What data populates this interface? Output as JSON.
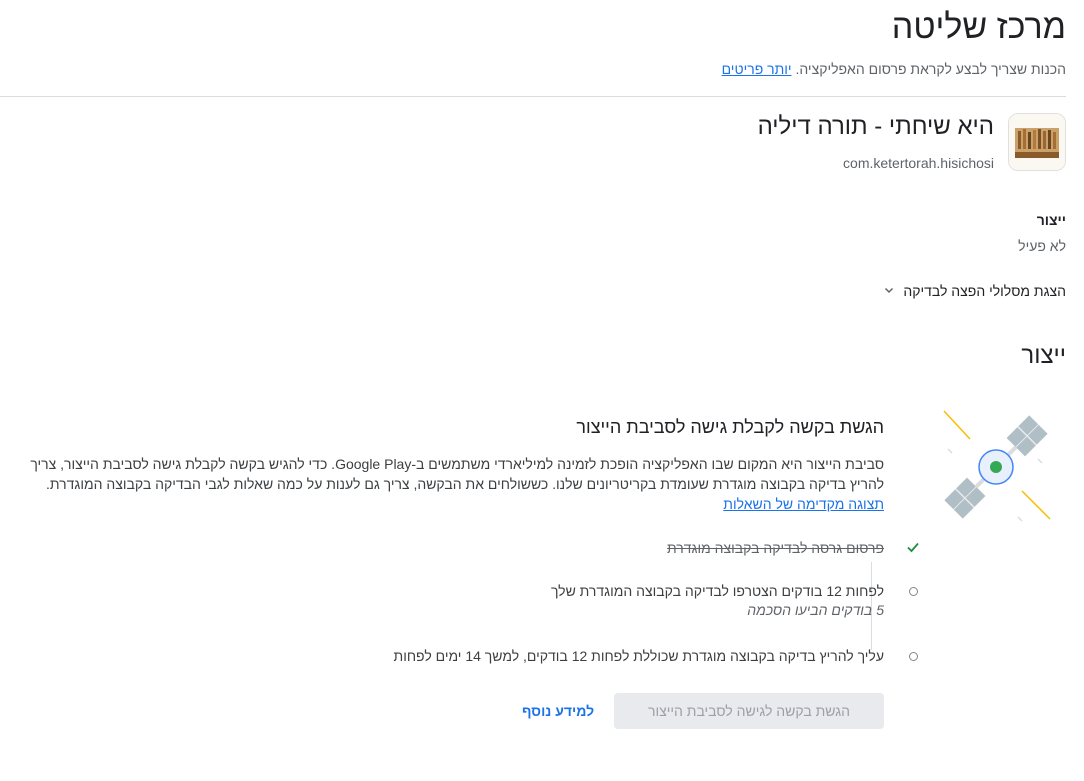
{
  "header": {
    "title": "מרכז שליטה",
    "subtitle": "הכנות שצריך לבצע לקראת פרסום האפליקציה.",
    "more_details_link": "יותר פריטים"
  },
  "app": {
    "name": "היא שיחתי - תורה דיליה",
    "package": "com.ketertorah.hisichosi",
    "icon_text": "היא שיחתי"
  },
  "production_status": {
    "label": "ייצור",
    "value": "לא פעיל"
  },
  "tracks_toggle_label": "הצגת מסלולי הפצה לבדיקה",
  "section": {
    "heading": "ייצור"
  },
  "card": {
    "title": "הגשת בקשה לקבלת גישה לסביבת הייצור",
    "body": "סביבת הייצור היא המקום שבו האפליקציה הופכת לזמינה למיליארדי משתמשים ב-Google Play. כדי להגיש בקשה לקבלת גישה לסביבת הייצור, צריך להריץ בדיקה בקבוצה מוגדרת שעומדת בקריטריונים שלנו. כששולחים את הבקשה, צריך גם לענות על כמה שאלות לגבי הבדיקה בקבוצה המוגדרת.",
    "preview_link": "תצוגה מקדימה של השאלות",
    "steps": [
      {
        "text": "פרסום גרסה לבדיקה בקבוצה מוגדרת",
        "done": true
      },
      {
        "text": "לפחות 12 בודקים הצטרפו לבדיקה בקבוצה המוגדרת שלך",
        "sub": "5 בודקים הביעו הסכמה",
        "done": false
      },
      {
        "text": "עליך להריץ בדיקה בקבוצה מוגדרת שכוללת לפחות 12 בודקים, למשך 14 ימים לפחות",
        "done": false
      }
    ],
    "submit_button": "הגשת בקשה לגישה לסביבת הייצור",
    "learn_more": "למידע נוסף"
  },
  "colors": {
    "accent": "#1a73e8",
    "check": "#1e8e3e",
    "satellite_dot": "#34a853"
  },
  "icons": [
    "chevron-down-icon",
    "check-icon",
    "satellite-illustration"
  ]
}
